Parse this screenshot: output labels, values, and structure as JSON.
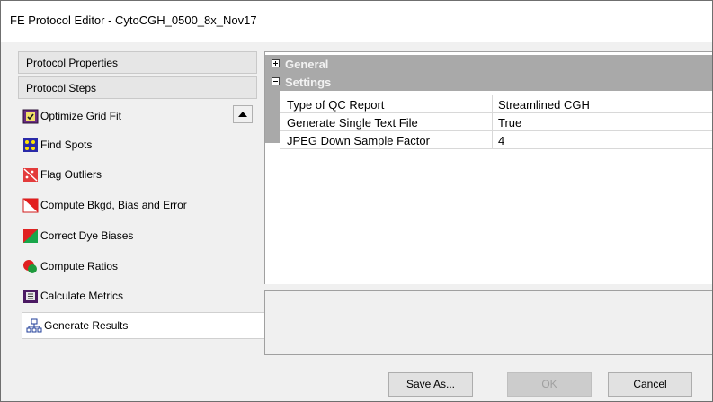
{
  "window": {
    "title": "FE Protocol Editor - CytoCGH_0500_8x_Nov17"
  },
  "left_panel": {
    "protocol_properties": "Protocol Properties",
    "protocol_steps": "Protocol Steps",
    "steps": [
      {
        "label": "Optimize Grid Fit",
        "icon": "optimize-grid-icon"
      },
      {
        "label": "Find Spots",
        "icon": "find-spots-icon"
      },
      {
        "label": "Flag Outliers",
        "icon": "flag-outliers-icon"
      },
      {
        "label": "Compute Bkgd, Bias and Error",
        "icon": "compute-bkgd-icon"
      },
      {
        "label": "Correct Dye Biases",
        "icon": "correct-dye-icon"
      },
      {
        "label": "Compute Ratios",
        "icon": "compute-ratios-icon"
      },
      {
        "label": "Calculate Metrics",
        "icon": "calculate-metrics-icon"
      },
      {
        "label": "Generate Results",
        "icon": "generate-results-icon"
      }
    ]
  },
  "property_grid": {
    "categories": [
      {
        "label": "General",
        "expanded": false
      },
      {
        "label": "Settings",
        "expanded": true
      }
    ],
    "rows": [
      {
        "name": "Type of QC Report",
        "value": "Streamlined CGH"
      },
      {
        "name": "Generate Single Text File",
        "value": "True"
      },
      {
        "name": "JPEG Down Sample Factor",
        "value": "4"
      }
    ]
  },
  "buttons": {
    "save_as": "Save As...",
    "ok": "OK",
    "cancel": "Cancel"
  },
  "colors": {
    "category_bg": "#a9a9a9",
    "window_bg": "#f0f0f0"
  }
}
